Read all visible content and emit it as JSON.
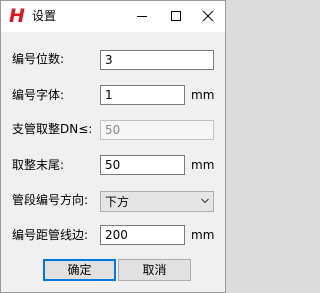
{
  "window": {
    "title": "设置",
    "icon": "H"
  },
  "fields": {
    "digits": {
      "label": "编号位数:",
      "value": "3"
    },
    "font_size": {
      "label": "编号字体:",
      "value": "1",
      "unit": "mm"
    },
    "round_dn": {
      "label": "支管取整DN≤:",
      "value": "50"
    },
    "round_tail": {
      "label": "取整末尾:",
      "value": "50",
      "unit": "mm"
    },
    "direction": {
      "label": "管段编号方向:",
      "value": "下方"
    },
    "distance": {
      "label": "编号距管线边:",
      "value": "200",
      "unit": "mm"
    }
  },
  "buttons": {
    "ok": "确定",
    "cancel": "取消"
  },
  "colors": {
    "icon_red": "#d8171f",
    "focus_blue": "#0078d7"
  }
}
